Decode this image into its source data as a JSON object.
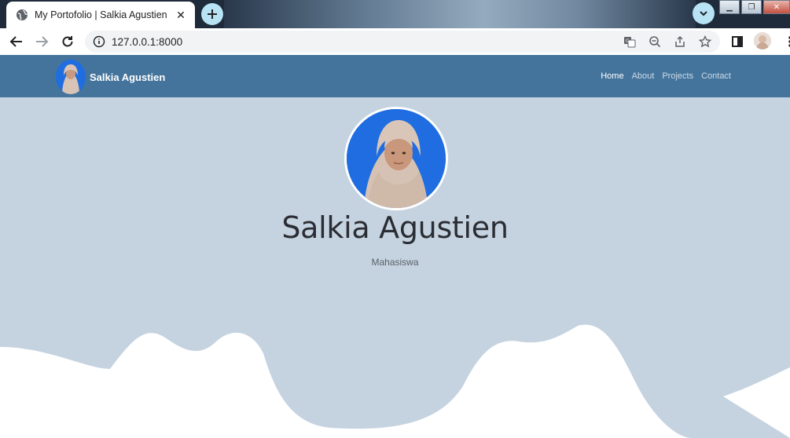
{
  "browser": {
    "tab_title": "My Portofolio | Salkia Agustien",
    "url": "127.0.0.1:8000"
  },
  "site": {
    "brand_name": "Salkia Agustien",
    "nav": [
      {
        "label": "Home",
        "active": true
      },
      {
        "label": "About",
        "active": false
      },
      {
        "label": "Projects",
        "active": false
      },
      {
        "label": "Contact",
        "active": false
      }
    ],
    "hero": {
      "name": "Salkia Agustien",
      "subtitle": "Mahasiswa"
    }
  },
  "colors": {
    "navbar": "#44749c",
    "hero_bg": "#c5d3e0",
    "photo_bg": "#1f6de0",
    "wave": "#ffffff"
  }
}
